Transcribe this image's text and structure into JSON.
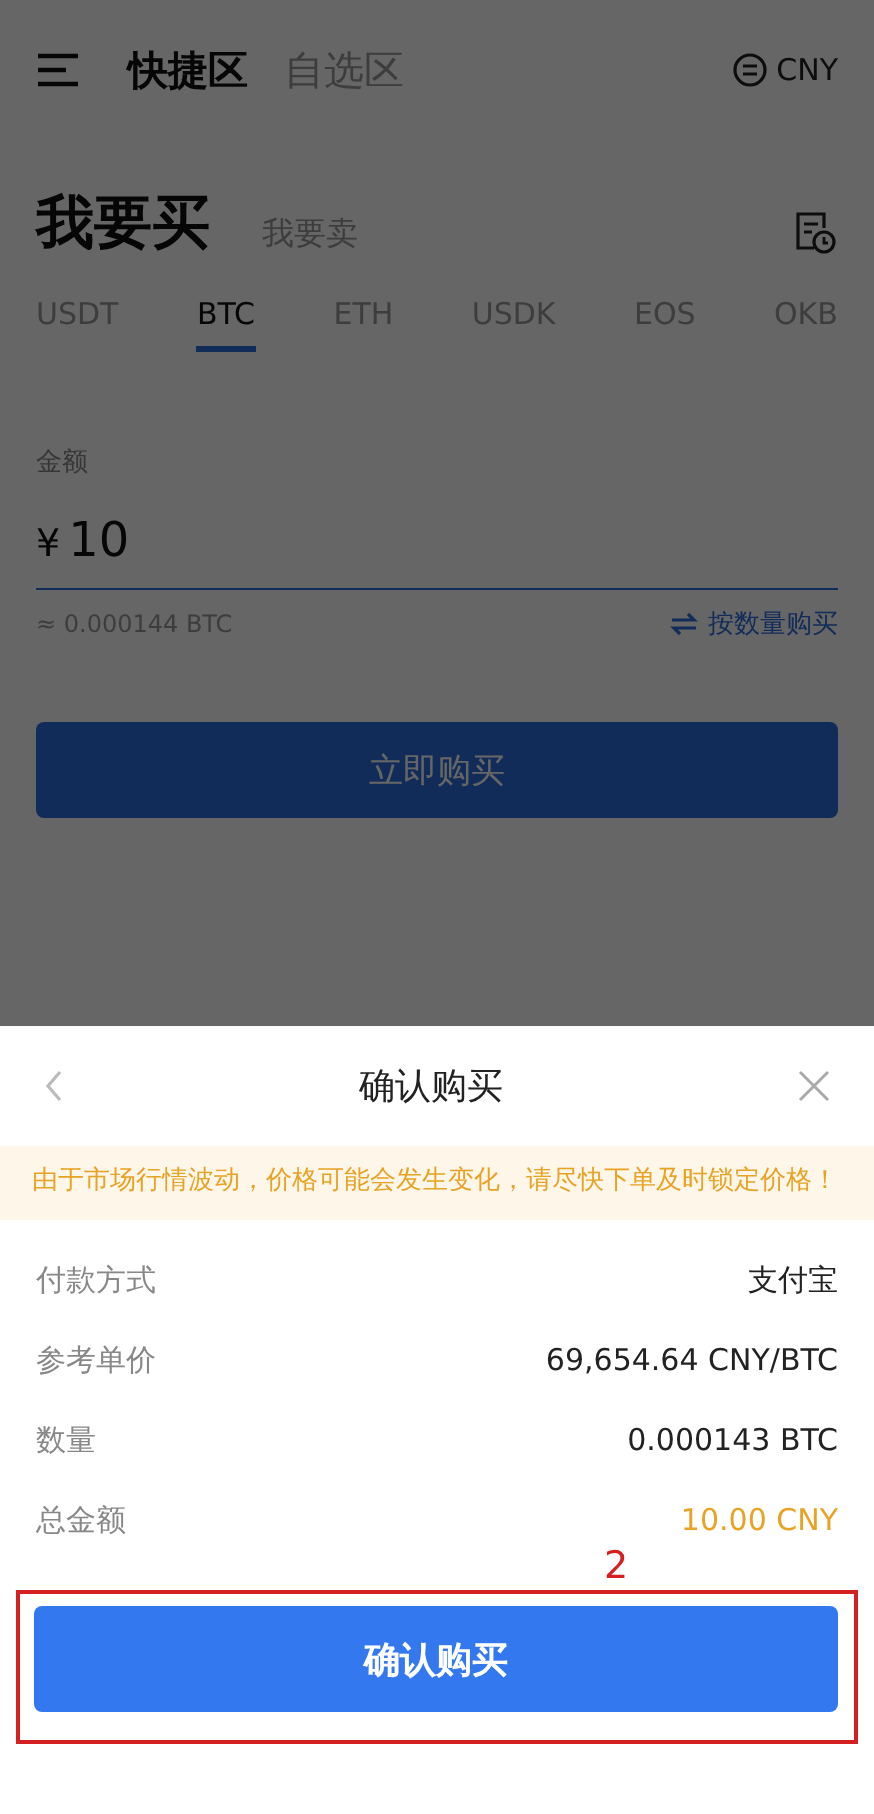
{
  "header": {
    "zones": [
      {
        "label": "快捷区",
        "selected": true
      },
      {
        "label": "自选区",
        "selected": false
      }
    ],
    "currency": "CNY"
  },
  "modes": [
    {
      "label": "我要买",
      "selected": true
    },
    {
      "label": "我要卖",
      "selected": false
    }
  ],
  "coins": [
    {
      "label": "USDT",
      "selected": false
    },
    {
      "label": "BTC",
      "selected": true
    },
    {
      "label": "ETH",
      "selected": false
    },
    {
      "label": "USDK",
      "selected": false
    },
    {
      "label": "EOS",
      "selected": false
    },
    {
      "label": "OKB",
      "selected": false
    }
  ],
  "amount": {
    "label": "金额",
    "symbol": "¥",
    "value": "10",
    "estimate": "≈ 0.000144 BTC",
    "switch_link": "按数量购买"
  },
  "buy_button": "立即购买",
  "sheet": {
    "title": "确认购买",
    "notice": "由于市场行情波动，价格可能会发生变化，请尽快下单及时锁定价格！",
    "rows": [
      {
        "label": "付款方式",
        "value": "支付宝",
        "highlight": false
      },
      {
        "label": "参考单价",
        "value": "69,654.64 CNY/BTC",
        "highlight": false
      },
      {
        "label": "数量",
        "value": "0.000143 BTC",
        "highlight": false
      },
      {
        "label": "总金额",
        "value": "10.00 CNY",
        "highlight": true
      }
    ],
    "confirm_button": "确认购买",
    "annotation": "2"
  }
}
